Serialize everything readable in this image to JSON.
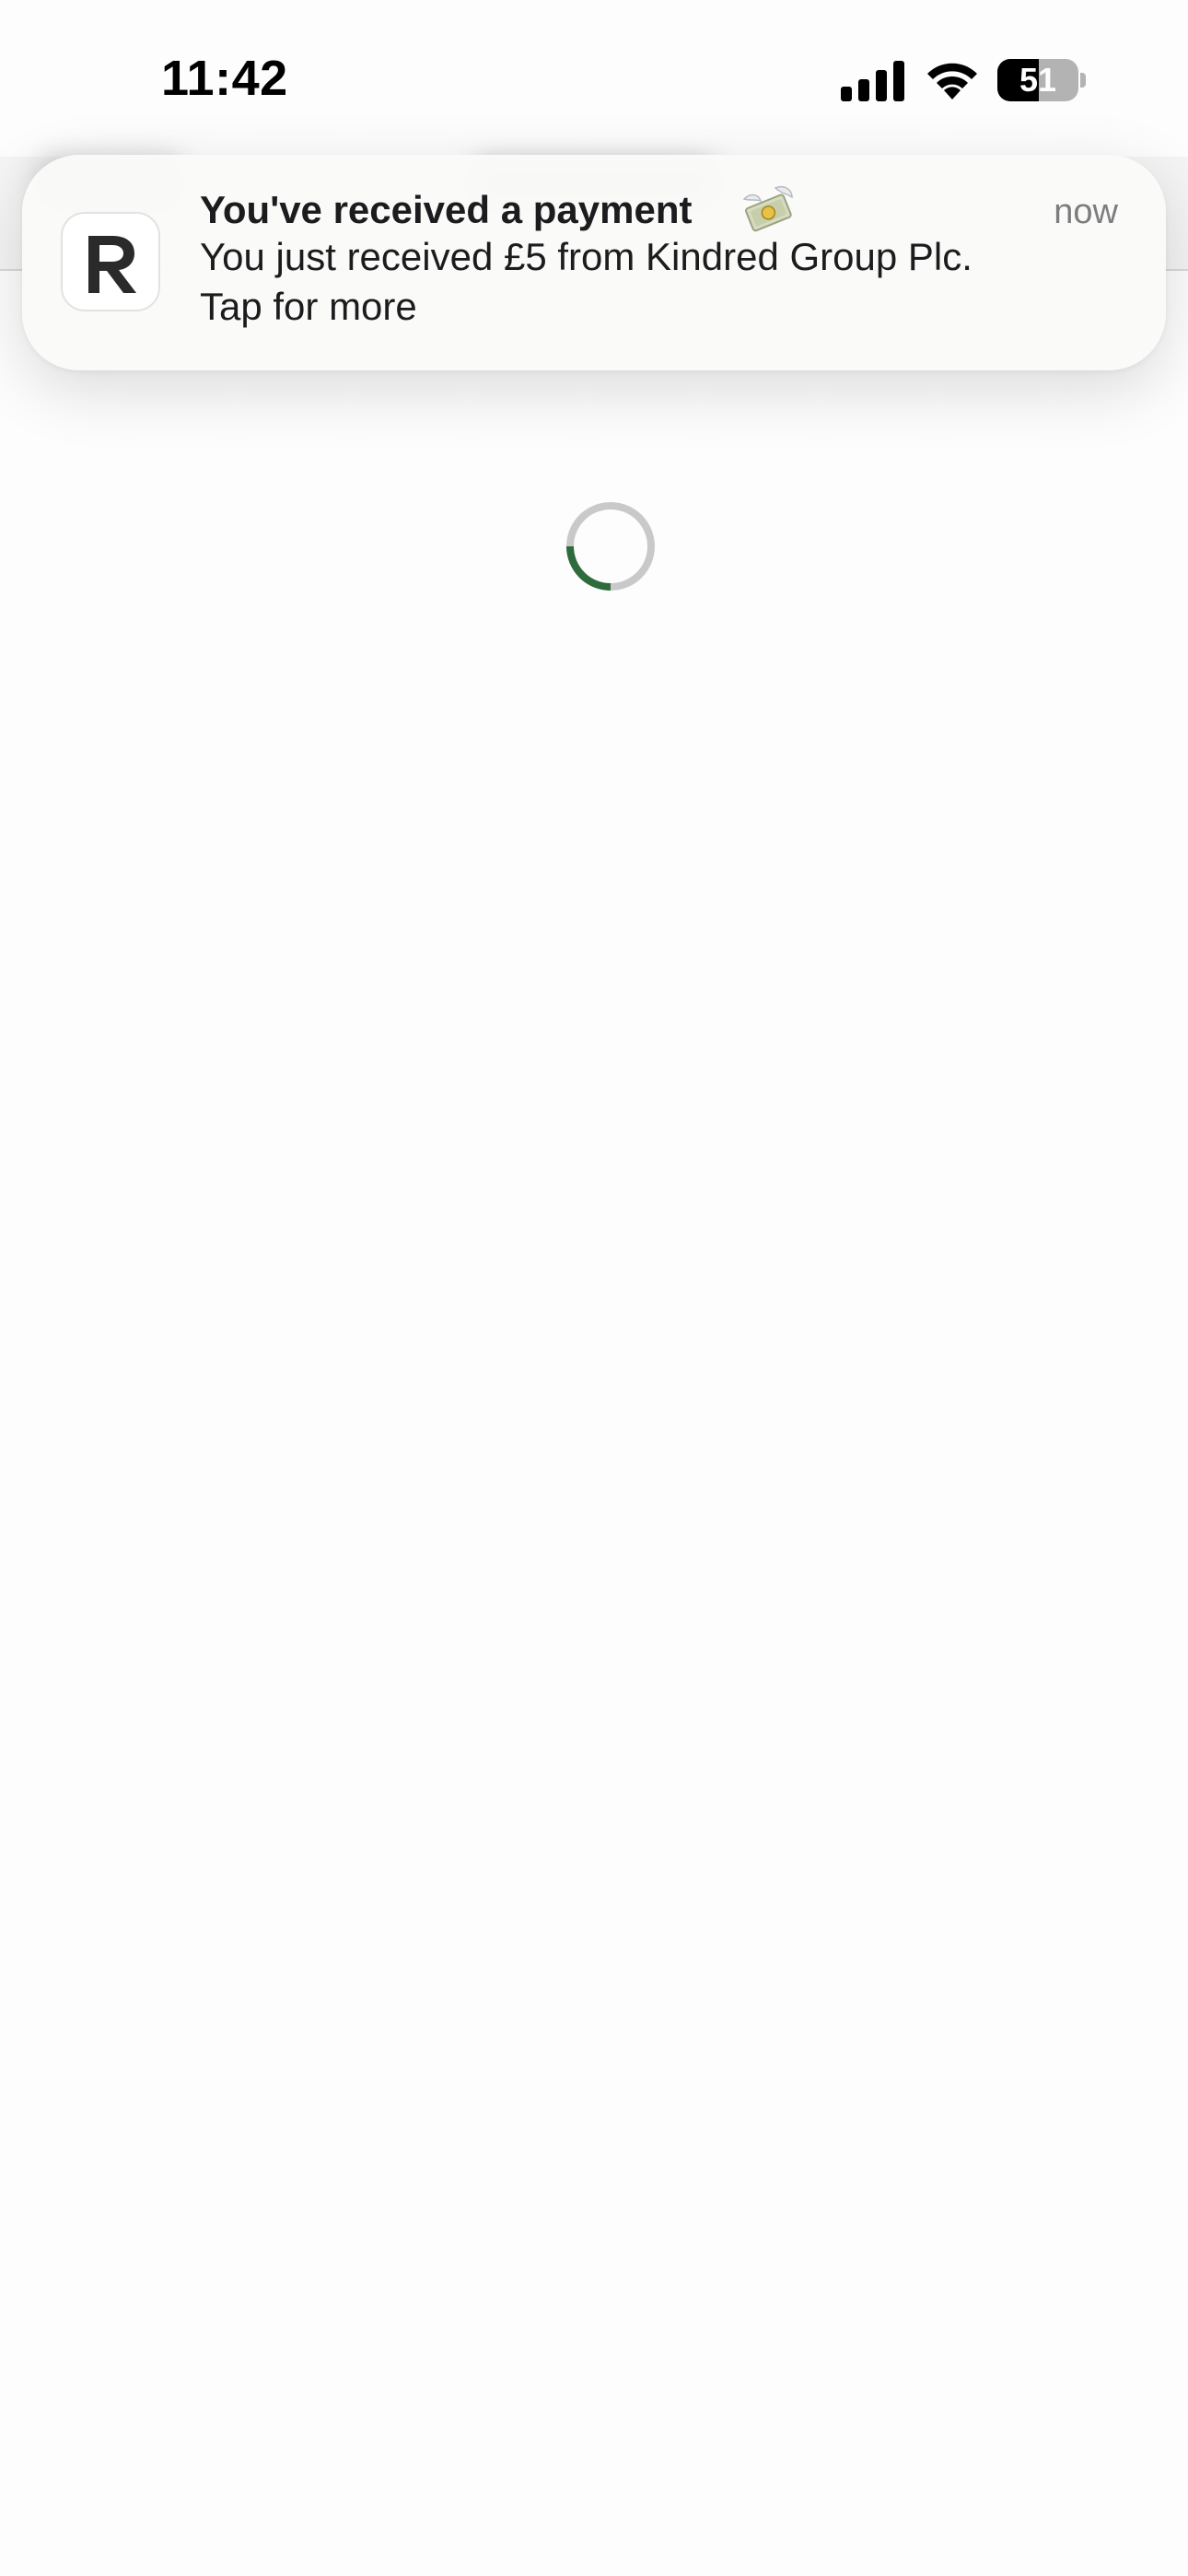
{
  "status_bar": {
    "time": "11:42",
    "battery_percent": "51",
    "battery_level": 0.51
  },
  "notification": {
    "title": "You've received a payment",
    "time": "now",
    "body_line1": "You just received £5 from Kindred Group Plc.",
    "body_line2": "Tap for more",
    "app_icon_letter": "R",
    "emoji_icon": "money-with-wings-icon"
  },
  "spinner": {
    "progress_color": "#2e6b3d",
    "track_color": "#c9c9c9"
  }
}
